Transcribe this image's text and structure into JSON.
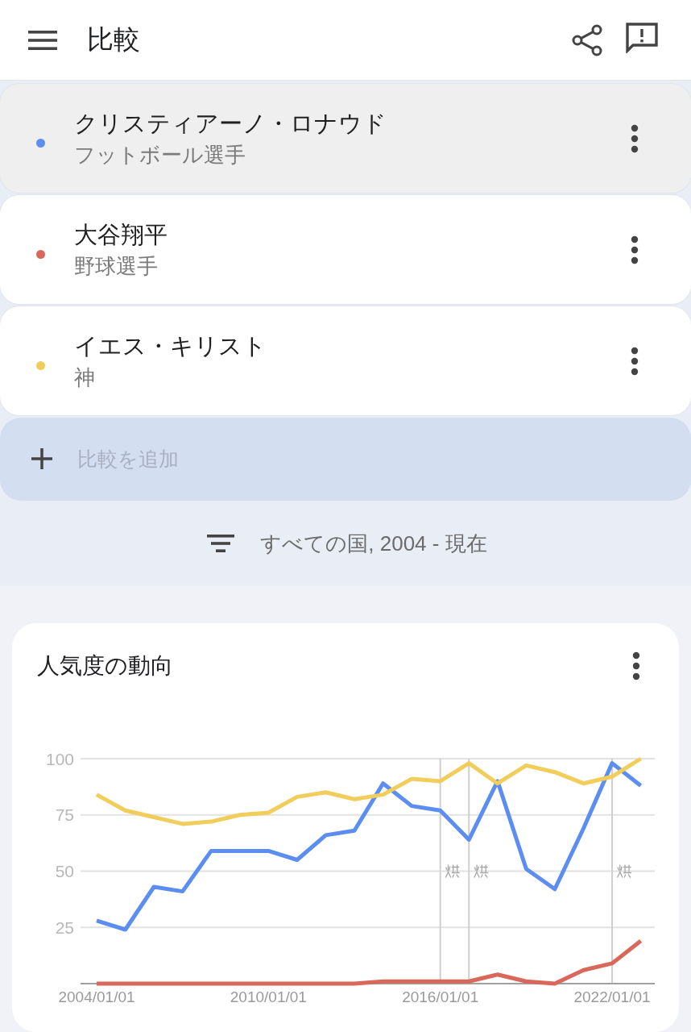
{
  "app_bar": {
    "title": "比較"
  },
  "terms": [
    {
      "name": "クリスティアーノ・ロナウド",
      "subtitle": "フットボール選手",
      "color": "#5b8ef0",
      "selected": true
    },
    {
      "name": "大谷翔平",
      "subtitle": "野球選手",
      "color": "#d9685b",
      "selected": false
    },
    {
      "name": "イエス・キリスト",
      "subtitle": "神",
      "color": "#f1cd5b",
      "selected": false
    }
  ],
  "add_comparison": {
    "placeholder": "比較を追加"
  },
  "filter": {
    "label": "すべての国, 2004 - 現在"
  },
  "interest_over_time": {
    "title": "人気度の動向",
    "chart_data": {
      "type": "line",
      "grid": true,
      "categories": [
        "2004/01/01",
        null,
        null,
        null,
        null,
        null,
        "2010/01/01",
        null,
        null,
        null,
        null,
        null,
        "2016/01/01",
        null,
        null,
        null,
        null,
        null,
        "2022/01/01",
        null
      ],
      "series": [
        {
          "color": "#5b8ef0",
          "values": [
            28,
            24,
            43,
            41,
            59,
            59,
            59,
            55,
            66,
            68,
            89,
            79,
            77,
            64,
            90,
            51,
            42,
            69,
            98,
            88
          ]
        },
        {
          "color": "#d9685b",
          "values": [
            0,
            0,
            0,
            0,
            0,
            0,
            0,
            0,
            0,
            0,
            1,
            1,
            1,
            1,
            4,
            1,
            0,
            6,
            9,
            19
          ]
        },
        {
          "color": "#f1cd5b",
          "values": [
            84,
            77,
            74,
            71,
            72,
            75,
            76,
            83,
            85,
            82,
            84,
            91,
            90,
            98,
            89,
            97,
            94,
            89,
            92,
            100
          ]
        }
      ],
      "ylim": [
        0,
        100
      ],
      "yticks": [
        25,
        50,
        75,
        100
      ]
    }
  }
}
